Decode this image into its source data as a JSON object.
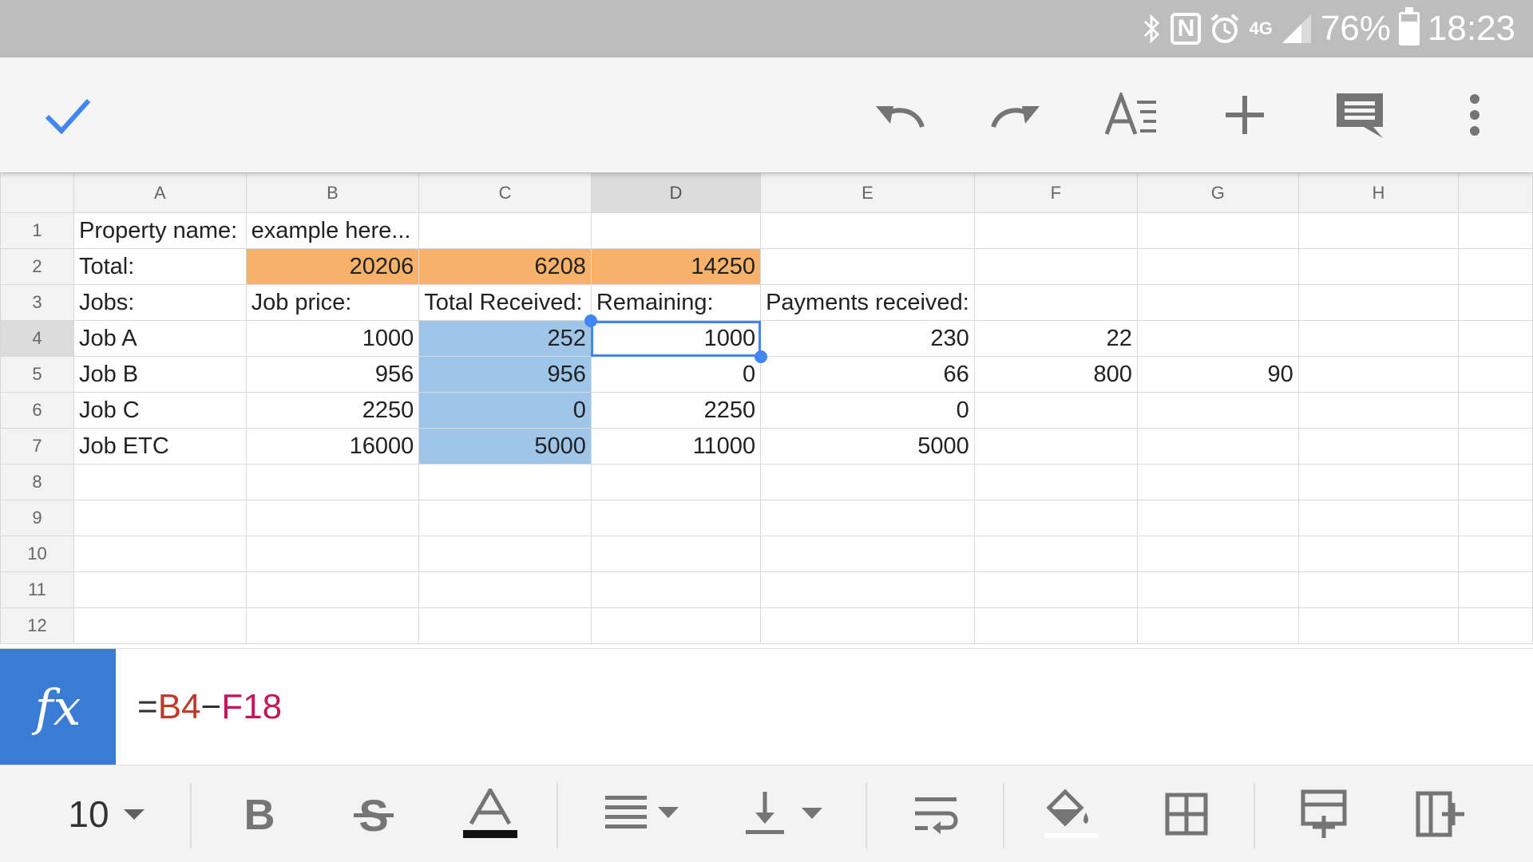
{
  "status_bar": {
    "network_label": "4G",
    "battery_percent": "76%",
    "battery_level": 0.76,
    "time": "18:23",
    "icons": [
      "bluetooth-icon",
      "nfc-icon",
      "alarm-icon",
      "signal-icon",
      "battery-icon"
    ]
  },
  "toolbar": {
    "icons": [
      "check-icon",
      "undo-icon",
      "redo-icon",
      "text-format-icon",
      "insert-plus-icon",
      "comment-icon",
      "more-vert-icon"
    ],
    "accent_color": "#4285f4"
  },
  "sheet": {
    "columns": [
      "A",
      "B",
      "C",
      "D",
      "E",
      "F",
      "G",
      "H"
    ],
    "selected_column": "D",
    "selected_row": 4,
    "active_cell": "D4",
    "rows": [
      {
        "num": "1",
        "cells": [
          "Property name:",
          "example here...",
          "",
          "",
          "",
          "",
          "",
          ""
        ]
      },
      {
        "num": "2",
        "cells": [
          "Total:",
          "20206",
          "6208",
          "14250",
          "",
          "",
          "",
          ""
        ]
      },
      {
        "num": "3",
        "cells": [
          "Jobs:",
          "Job price:",
          "Total Received:",
          "Remaining:",
          "Payments received:",
          "",
          "",
          ""
        ]
      },
      {
        "num": "4",
        "cells": [
          "Job A",
          "1000",
          "252",
          "1000",
          "230",
          "22",
          "",
          ""
        ]
      },
      {
        "num": "5",
        "cells": [
          "Job B",
          "956",
          "956",
          "0",
          "66",
          "800",
          "90",
          ""
        ]
      },
      {
        "num": "6",
        "cells": [
          "Job C",
          "2250",
          "0",
          "2250",
          "0",
          "",
          "",
          ""
        ]
      },
      {
        "num": "7",
        "cells": [
          "Job ETC",
          "16000",
          "5000",
          "11000",
          "5000",
          "",
          "",
          ""
        ]
      },
      {
        "num": "8",
        "cells": [
          "",
          "",
          "",
          "",
          "",
          "",
          "",
          ""
        ]
      },
      {
        "num": "9",
        "cells": [
          "",
          "",
          "",
          "",
          "",
          "",
          "",
          ""
        ]
      },
      {
        "num": "10",
        "cells": [
          "",
          "",
          "",
          "",
          "",
          "",
          "",
          ""
        ]
      },
      {
        "num": "11",
        "cells": [
          "",
          "",
          "",
          "",
          "",
          "",
          "",
          ""
        ]
      },
      {
        "num": "12",
        "cells": [
          "",
          "",
          "",
          "",
          "",
          "",
          "",
          ""
        ]
      }
    ],
    "highlight_colors": {
      "orange": "#f6b26b",
      "blue": "#9fc5e8"
    }
  },
  "formula_bar": {
    "fx_label": "fx",
    "equals": "=",
    "ref1": "B4",
    "operator": "−",
    "ref2": "F18",
    "fx_color": "#3a7bd5"
  },
  "format_bar": {
    "font_size": "10",
    "icons": [
      "font-size-dropdown-icon",
      "bold-icon",
      "strikethrough-icon",
      "text-color-icon",
      "horizontal-align-icon",
      "vertical-align-icon",
      "text-wrap-icon",
      "fill-color-icon",
      "borders-icon",
      "insert-row-icon",
      "insert-column-icon"
    ]
  }
}
